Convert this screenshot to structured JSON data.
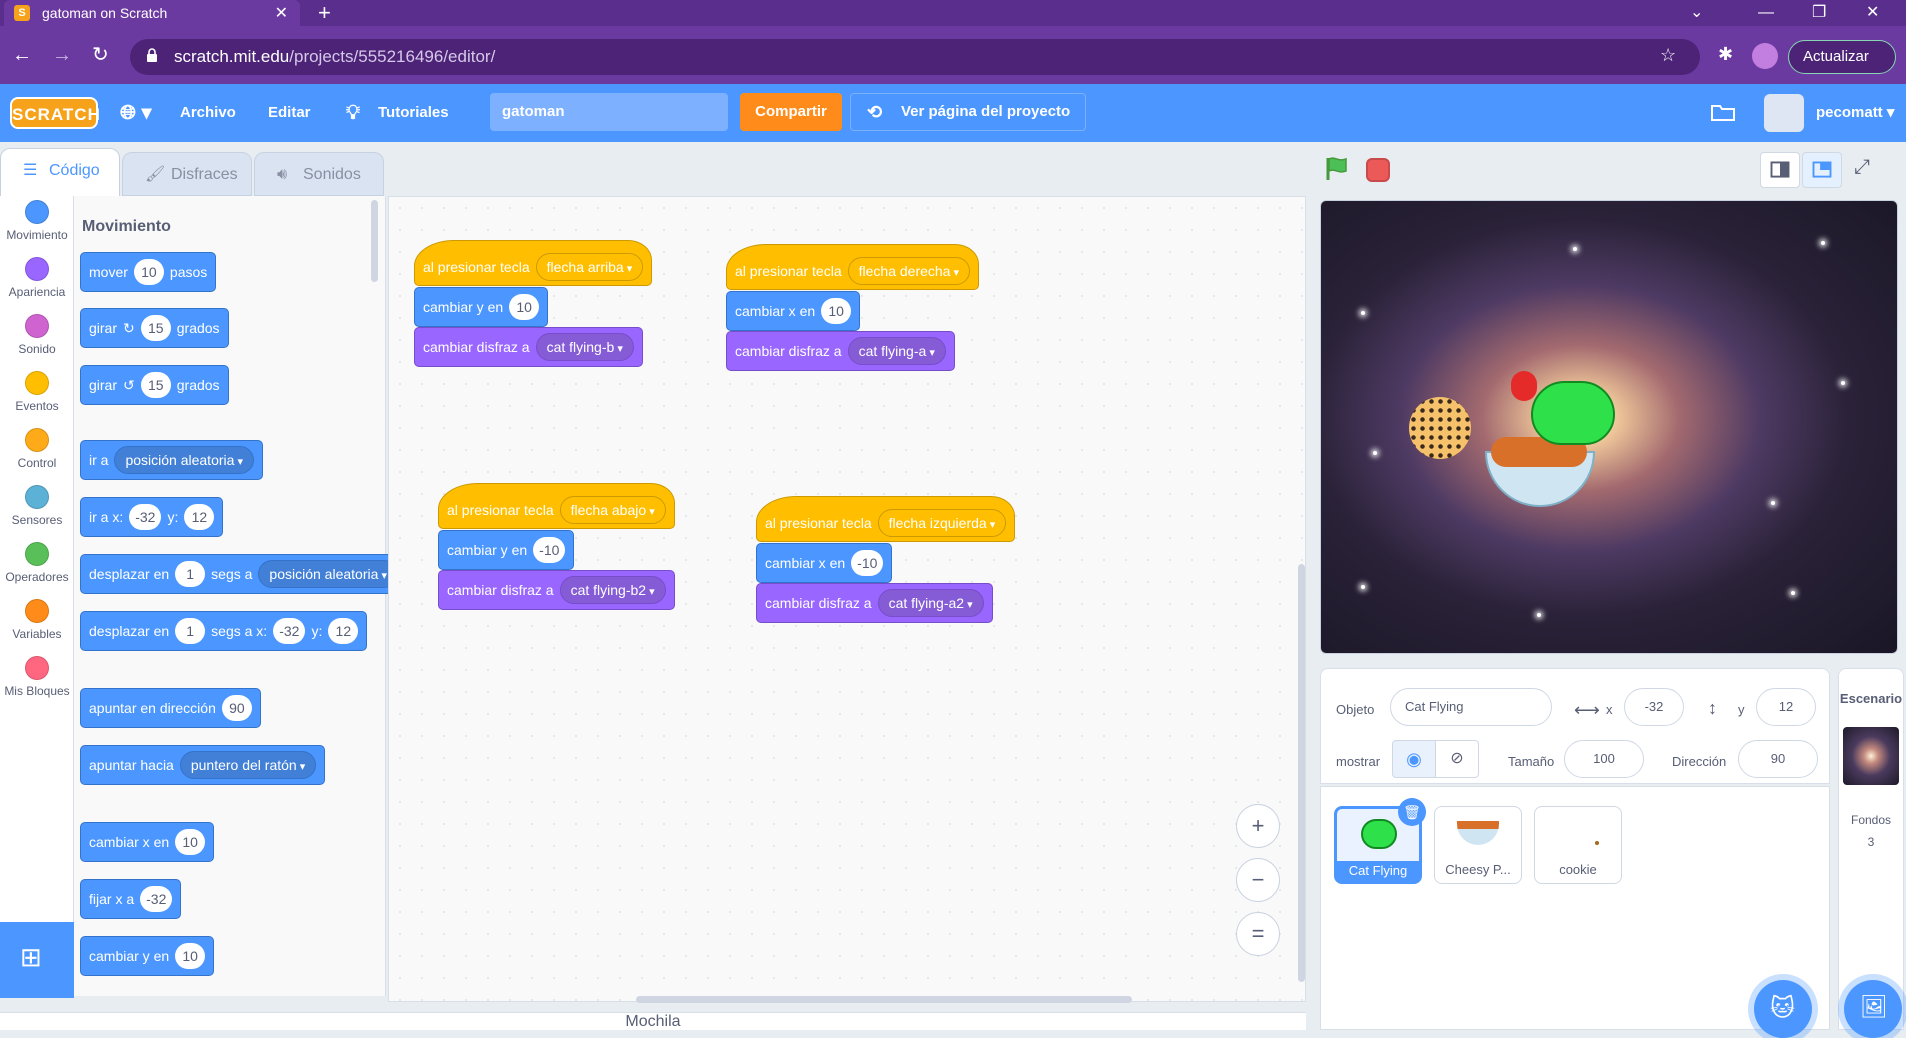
{
  "browser": {
    "tab_title": "gatoman on Scratch",
    "url_host": "scratch.mit.edu",
    "url_path": "/projects/555216496/editor/",
    "update_label": "Actualizar"
  },
  "menu": {
    "archivo": "Archivo",
    "editar": "Editar",
    "tutoriales": "Tutoriales",
    "project_title": "gatoman",
    "share": "Compartir",
    "see_project": "Ver página del proyecto",
    "username": "pecomatt"
  },
  "tabs": {
    "code": "Código",
    "costumes": "Disfraces",
    "sounds": "Sonidos"
  },
  "categories": [
    {
      "label": "Movimiento",
      "color": "#4c97ff"
    },
    {
      "label": "Apariencia",
      "color": "#9966ff"
    },
    {
      "label": "Sonido",
      "color": "#cf63cf"
    },
    {
      "label": "Eventos",
      "color": "#ffbf00"
    },
    {
      "label": "Control",
      "color": "#ffab19"
    },
    {
      "label": "Sensores",
      "color": "#5cb1d6"
    },
    {
      "label": "Operadores",
      "color": "#59c059"
    },
    {
      "label": "Variables",
      "color": "#ff8c1a"
    },
    {
      "label": "Mis Bloques",
      "color": "#ff6680"
    }
  ],
  "palette": {
    "title": "Movimiento",
    "move": {
      "a": "mover",
      "v": "10",
      "b": "pasos"
    },
    "turn_right": {
      "a": "girar",
      "v": "15",
      "b": "grados"
    },
    "turn_left": {
      "a": "girar",
      "v": "15",
      "b": "grados"
    },
    "goto": {
      "a": "ir a",
      "dd": "posición aleatoria"
    },
    "goto_xy": {
      "a": "ir a x:",
      "x": "-32",
      "yl": "y:",
      "y": "12"
    },
    "glide": {
      "a": "desplazar en",
      "v": "1",
      "b": "segs a",
      "dd": "posición aleatoria"
    },
    "glide_xy": {
      "a": "desplazar en",
      "v": "1",
      "b": "segs a x:",
      "x": "-32",
      "yl": "y:",
      "y": "12"
    },
    "point_dir": {
      "a": "apuntar en dirección",
      "v": "90"
    },
    "point_towards": {
      "a": "apuntar hacia",
      "dd": "puntero del ratón"
    },
    "change_x": {
      "a": "cambiar x en",
      "v": "10"
    },
    "set_x": {
      "a": "fijar x a",
      "v": "-32"
    },
    "change_y": {
      "a": "cambiar y en",
      "v": "10"
    }
  },
  "scripts": [
    {
      "hat": "al presionar tecla",
      "key": "flecha arriba",
      "m": "cambiar y en",
      "mv": "10",
      "l": "cambiar disfraz a",
      "costume": "cat flying-b"
    },
    {
      "hat": "al presionar tecla",
      "key": "flecha derecha",
      "m": "cambiar x en",
      "mv": "10",
      "l": "cambiar disfraz a",
      "costume": "cat flying-a"
    },
    {
      "hat": "al presionar tecla",
      "key": "flecha abajo",
      "m": "cambiar y en",
      "mv": "-10",
      "l": "cambiar disfraz a",
      "costume": "cat flying-b2"
    },
    {
      "hat": "al presionar tecla",
      "key": "flecha izquierda",
      "m": "cambiar x en",
      "mv": "-10",
      "l": "cambiar disfraz a",
      "costume": "cat flying-a2"
    }
  ],
  "zoom": {
    "in": "+",
    "out": "−",
    "reset": "="
  },
  "backpack": "Mochila",
  "sprite_info": {
    "objeto_label": "Objeto",
    "sprite_name": "Cat Flying",
    "x_label": "x",
    "x": "-32",
    "y_label": "y",
    "y": "12",
    "show_label": "mostrar",
    "size_label": "Tamaño",
    "size": "100",
    "direction_label": "Dirección",
    "direction": "90"
  },
  "sprites": [
    {
      "name": "Cat Flying"
    },
    {
      "name": "Cheesy P..."
    },
    {
      "name": "cookie"
    }
  ],
  "backdrop": {
    "title": "Escenario",
    "label": "Fondos",
    "count": "3"
  },
  "icons": [
    "scratch-logo",
    "globe-icon",
    "lightbulb-icon",
    "remix-icon",
    "folder-icon",
    "green-flag-icon",
    "stop-icon",
    "layout-small-icon",
    "layout-large-icon",
    "fullscreen-icon",
    "eye-icon",
    "eye-off-icon",
    "trash-icon",
    "add-sprite-icon",
    "add-backdrop-icon",
    "extension-icon"
  ]
}
